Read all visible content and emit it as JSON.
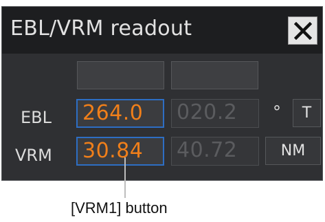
{
  "window": {
    "title": "EBL/VRM readout",
    "close_icon": "close-icon"
  },
  "header_buttons": [
    "",
    ""
  ],
  "ebl": {
    "label": "EBL",
    "value_1": "264.0",
    "value_2": "020.2",
    "unit": "°",
    "mode_button": "T"
  },
  "vrm": {
    "label": "VRM",
    "value_1": "30.84",
    "value_2": "40.72",
    "unit_button": "NM"
  },
  "annotation": {
    "caption": "[VRM1] button"
  },
  "colors": {
    "active_value": "#f07f1a",
    "active_border": "#2d6ec4",
    "dim_value": "#5b5c5f",
    "panel_bg": "#2f3033",
    "title_bg": "#1d1e20"
  }
}
